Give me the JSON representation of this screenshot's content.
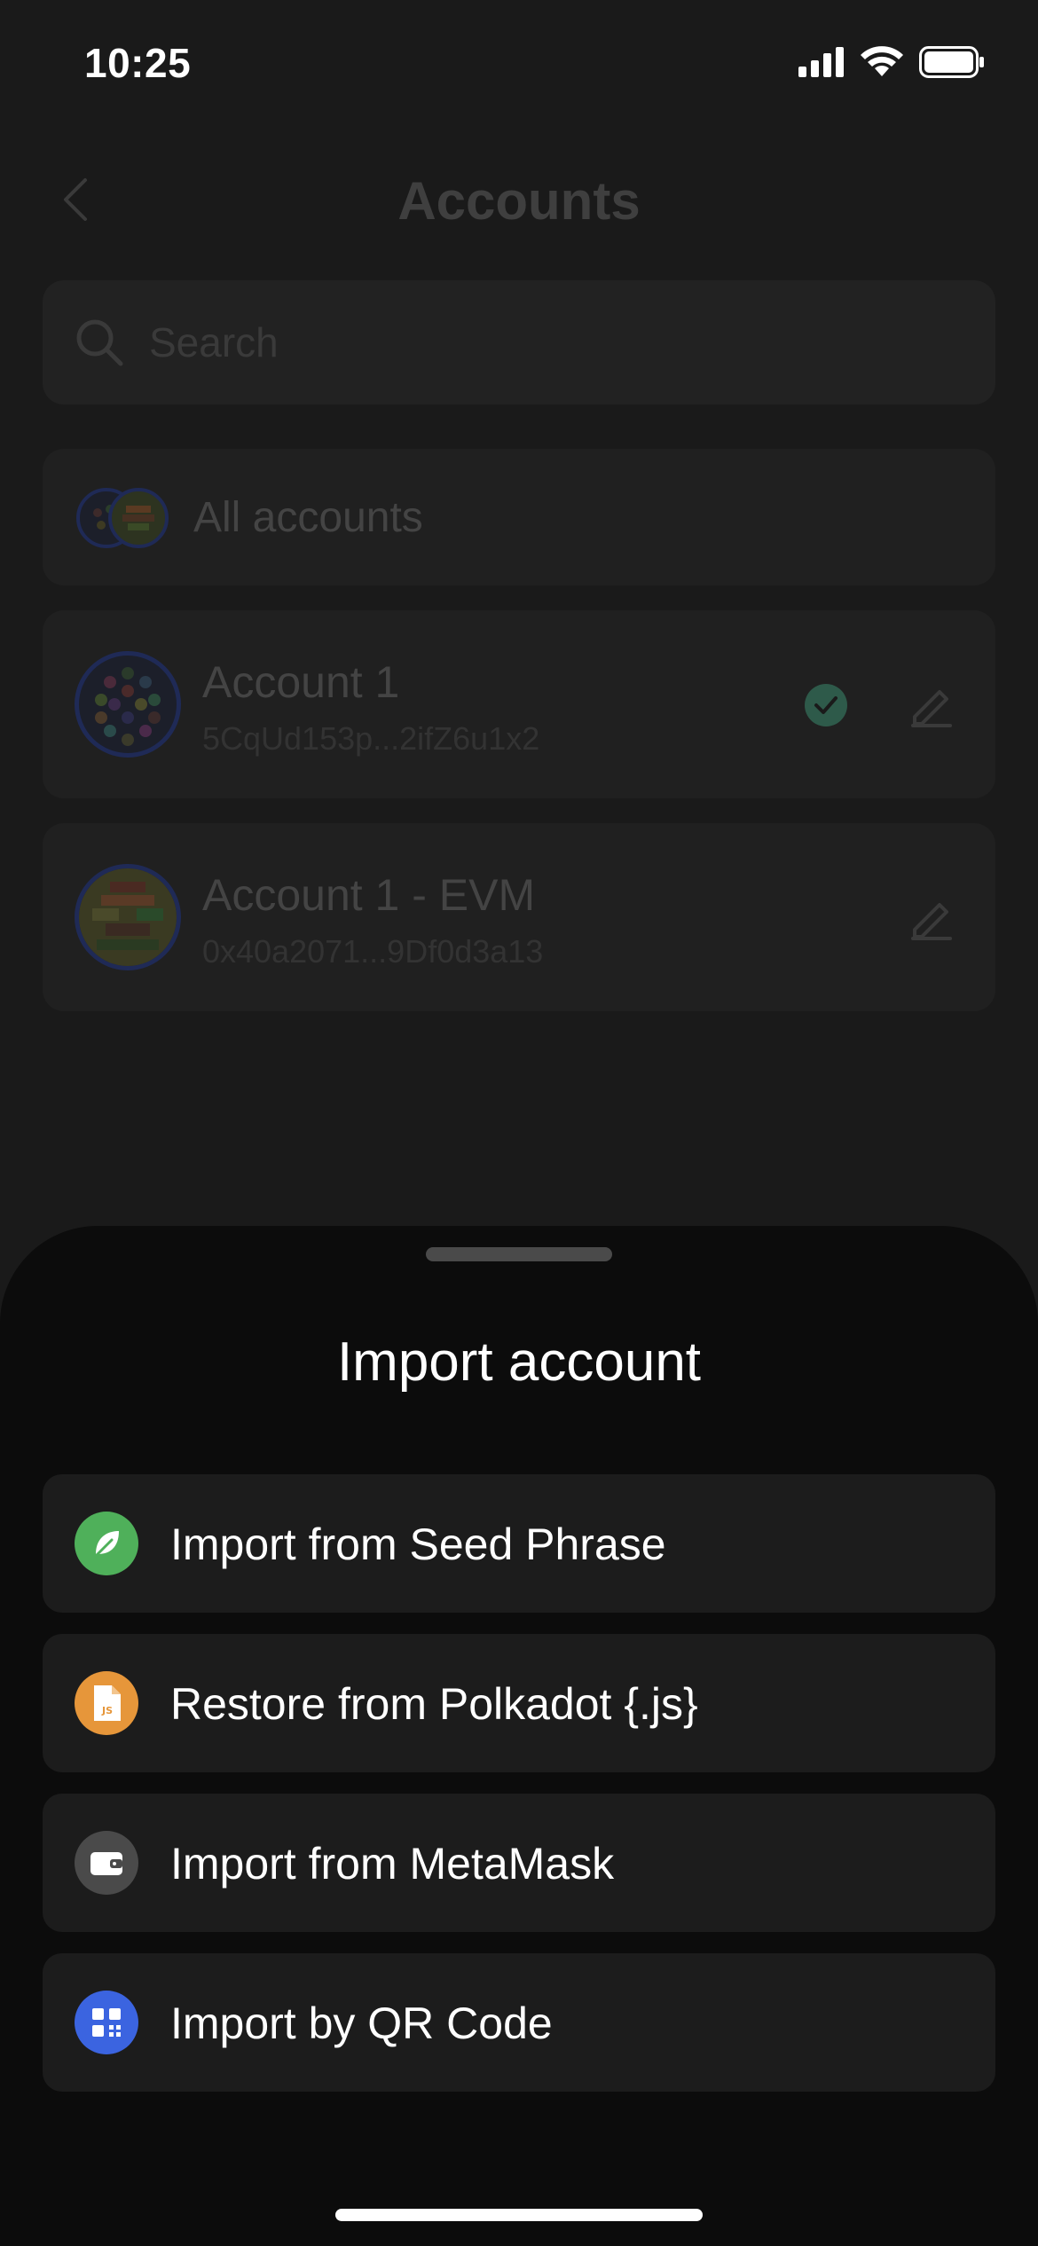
{
  "status_bar": {
    "time": "10:25"
  },
  "header": {
    "title": "Accounts"
  },
  "search": {
    "placeholder": "Search"
  },
  "all_accounts": {
    "label": "All accounts"
  },
  "accounts": [
    {
      "name": "Account 1",
      "address": "5CqUd153p...2ifZ6u1x2",
      "selected": true
    },
    {
      "name": "Account 1 - EVM",
      "address": "0x40a2071...9Df0d3a13",
      "selected": false
    }
  ],
  "sheet": {
    "title": "Import account",
    "options": [
      {
        "label": "Import from Seed Phrase",
        "icon": "leaf-icon",
        "color": "#4fb05a"
      },
      {
        "label": "Restore from Polkadot {.js}",
        "icon": "js-file-icon",
        "color": "#e6963a"
      },
      {
        "label": "Import from MetaMask",
        "icon": "wallet-icon",
        "color": "#4a4a4a"
      },
      {
        "label": "Import by QR Code",
        "icon": "qr-code-icon",
        "color": "#3b64e0"
      }
    ]
  },
  "colors": {
    "accent_green": "#2e5a4a",
    "sheet_bg": "#0c0c0c"
  }
}
